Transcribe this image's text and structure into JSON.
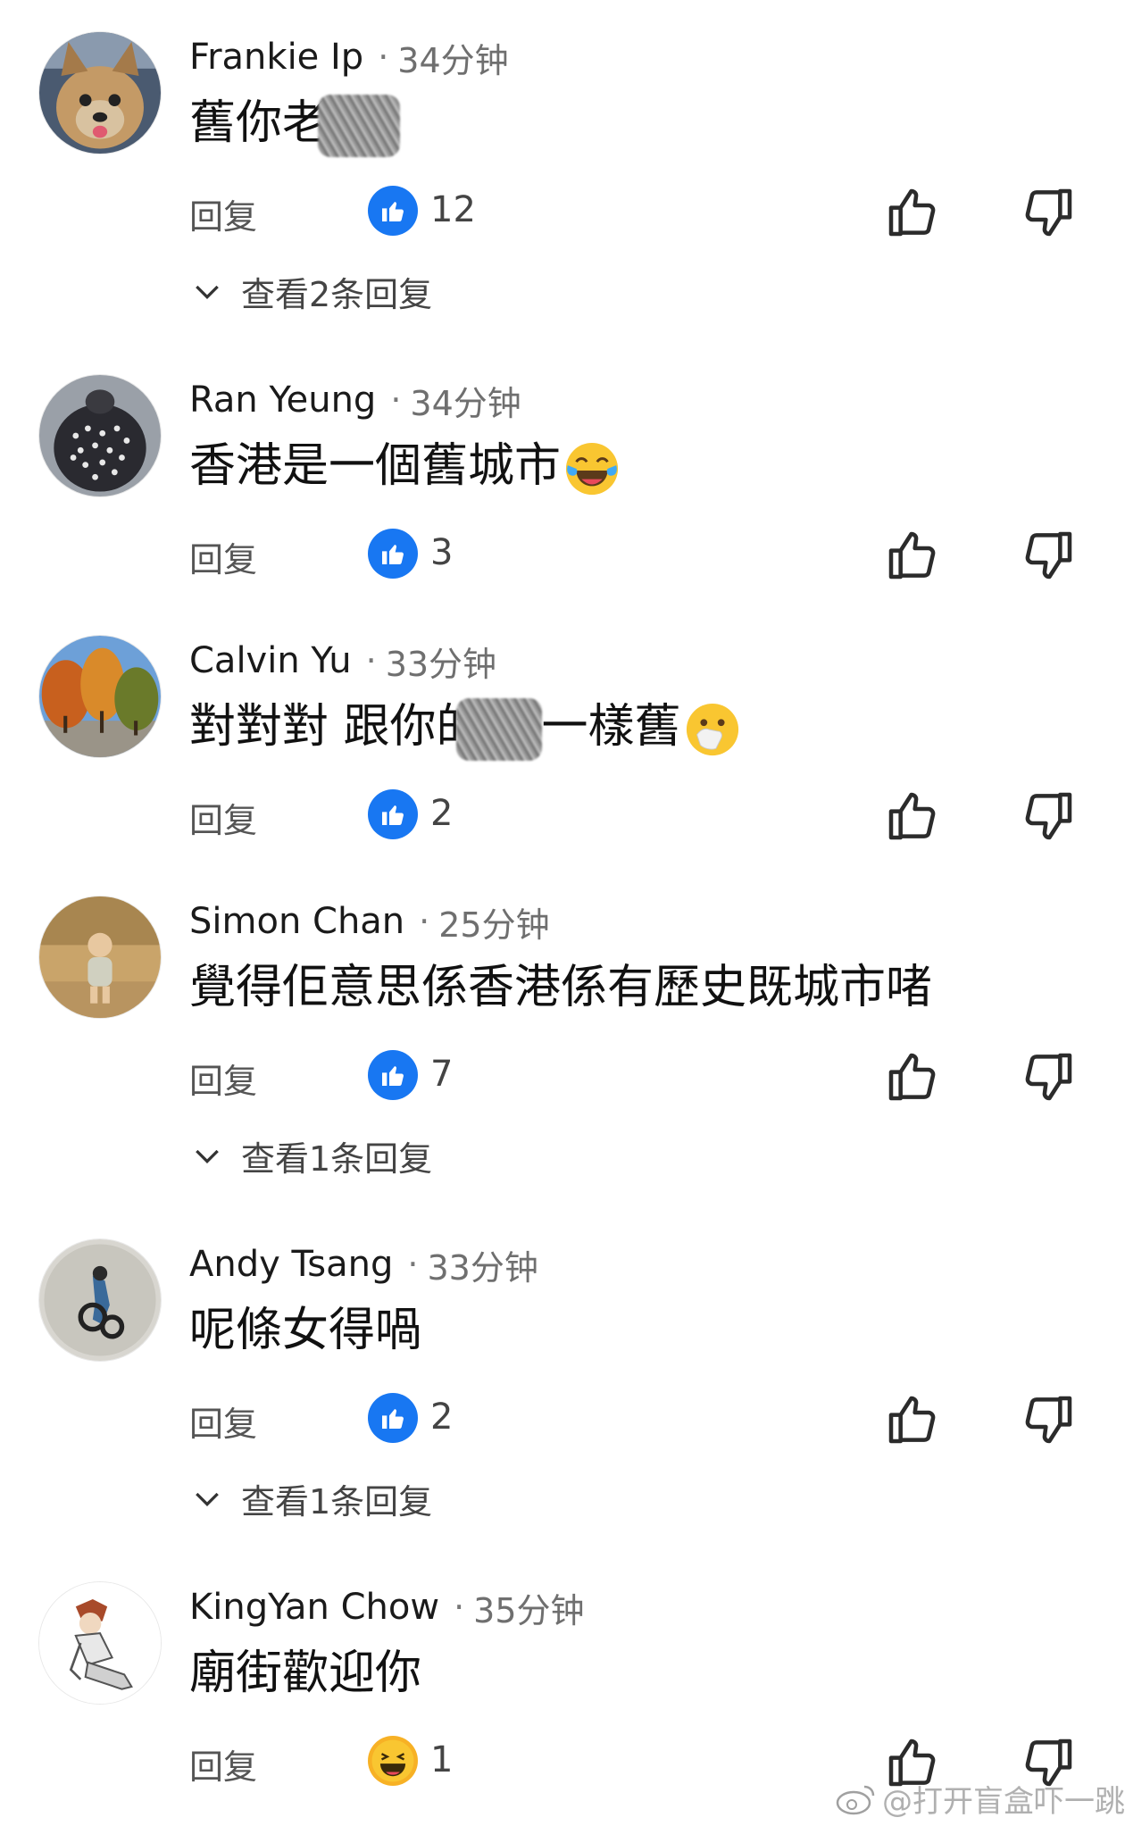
{
  "labels": {
    "reply": "回复"
  },
  "comments": [
    {
      "author": "Frankie Ip",
      "time": "34分钟",
      "text_before": "舊你老",
      "text_after": "",
      "redacted": true,
      "emoji": "",
      "reaction": "like",
      "count": "12",
      "view_replies": "查看2条回复",
      "avatar": "dog"
    },
    {
      "author": "Ran Yeung",
      "time": "34分钟",
      "text_before": "香港是一個舊城市",
      "text_after": "",
      "redacted": false,
      "emoji": "joy",
      "reaction": "like",
      "count": "3",
      "view_replies": "",
      "avatar": "bird"
    },
    {
      "author": "Calvin Yu",
      "time": "33分钟",
      "text_before": "對對對 跟你的",
      "text_after": "一樣舊",
      "redacted": true,
      "emoji": "hand-over-mouth",
      "reaction": "like",
      "count": "2",
      "view_replies": "",
      "avatar": "trees"
    },
    {
      "author": "Simon Chan",
      "time": "25分钟",
      "text_before": "覺得佢意思係香港係有歷史既城市啫",
      "text_after": "",
      "redacted": false,
      "emoji": "",
      "reaction": "like",
      "count": "7",
      "view_replies": "查看1条回复",
      "avatar": "child"
    },
    {
      "author": "Andy Tsang",
      "time": "33分钟",
      "text_before": "呢條女得喎",
      "text_after": "",
      "redacted": false,
      "emoji": "",
      "reaction": "like",
      "count": "2",
      "view_replies": "查看1条回复",
      "avatar": "moto"
    },
    {
      "author": "KingYan Chow",
      "time": "35分钟",
      "text_before": "廟街歡迎你",
      "text_after": "",
      "redacted": false,
      "emoji": "",
      "reaction": "haha",
      "count": "1",
      "view_replies": "",
      "avatar": "anime"
    }
  ],
  "watermark": "@打开盲盒吓一跳",
  "colors": {
    "like_blue": "#1877f2",
    "haha_yellow": "#f7b125"
  }
}
